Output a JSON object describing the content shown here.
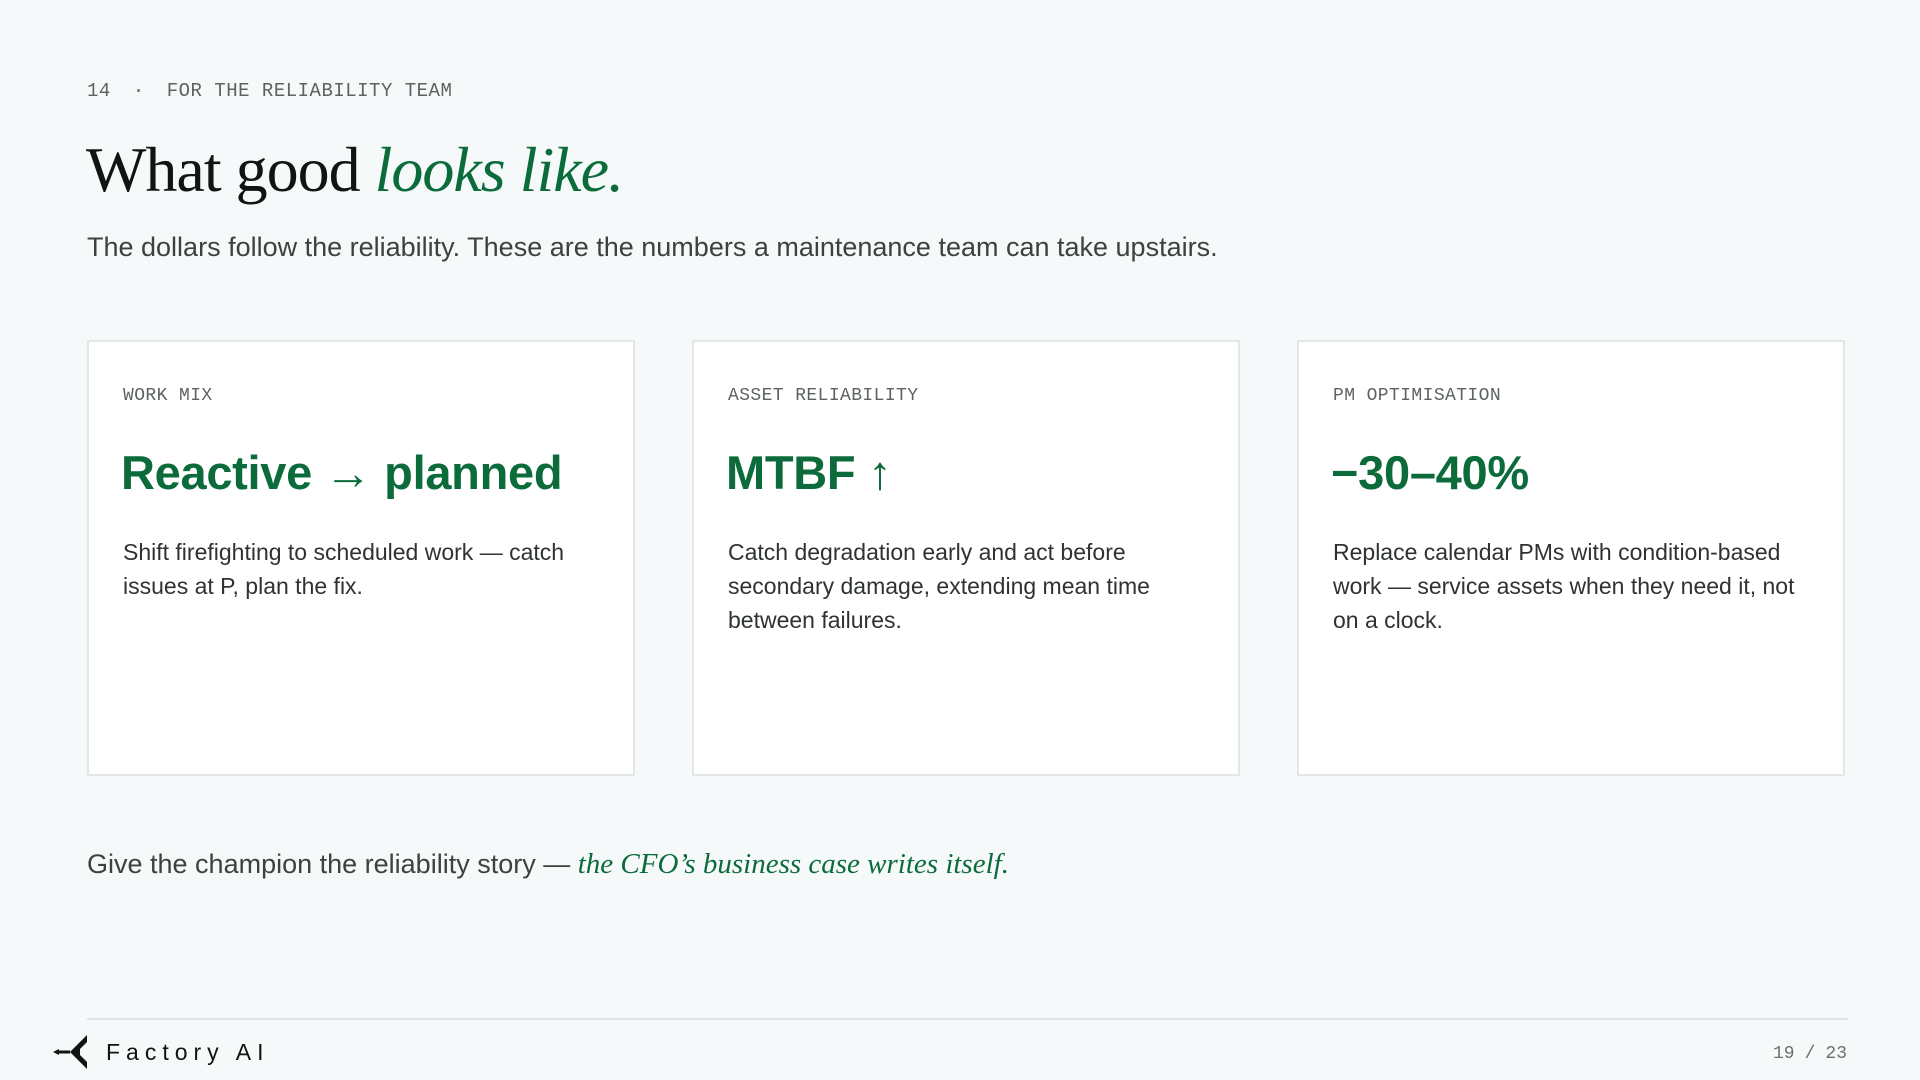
{
  "header": {
    "section_number": "14",
    "separator": "·",
    "section_label": "FOR THE RELIABILITY TEAM",
    "title_plain": "What good ",
    "title_accent": "looks like.",
    "subtitle": "The dollars follow the reliability. These are the numbers a maintenance team can take upstairs."
  },
  "cards": [
    {
      "label": "WORK MIX",
      "value": "Reactive → planned",
      "description": "Shift firefighting to scheduled work — catch issues at P, plan the fix."
    },
    {
      "label": "ASSET RELIABILITY",
      "value": "MTBF ↑",
      "description": "Catch degradation early and act before secondary damage, extending mean time between failures."
    },
    {
      "label": "PM OPTIMISATION",
      "value": "−30–40%",
      "description": "Replace calendar PMs with condition-based work — service assets when they need it, not on a clock."
    }
  ],
  "footnote": {
    "plain": "Give the champion the reliability story — ",
    "accent": "the CFO’s business case writes itself."
  },
  "footer": {
    "logo_text": "Factory AI",
    "current_page": "19",
    "page_separator": "/",
    "total_pages": "23"
  },
  "colors": {
    "accent_green": "#0c6b3b",
    "background": "#f6f9fa",
    "card_background": "#ffffff"
  }
}
